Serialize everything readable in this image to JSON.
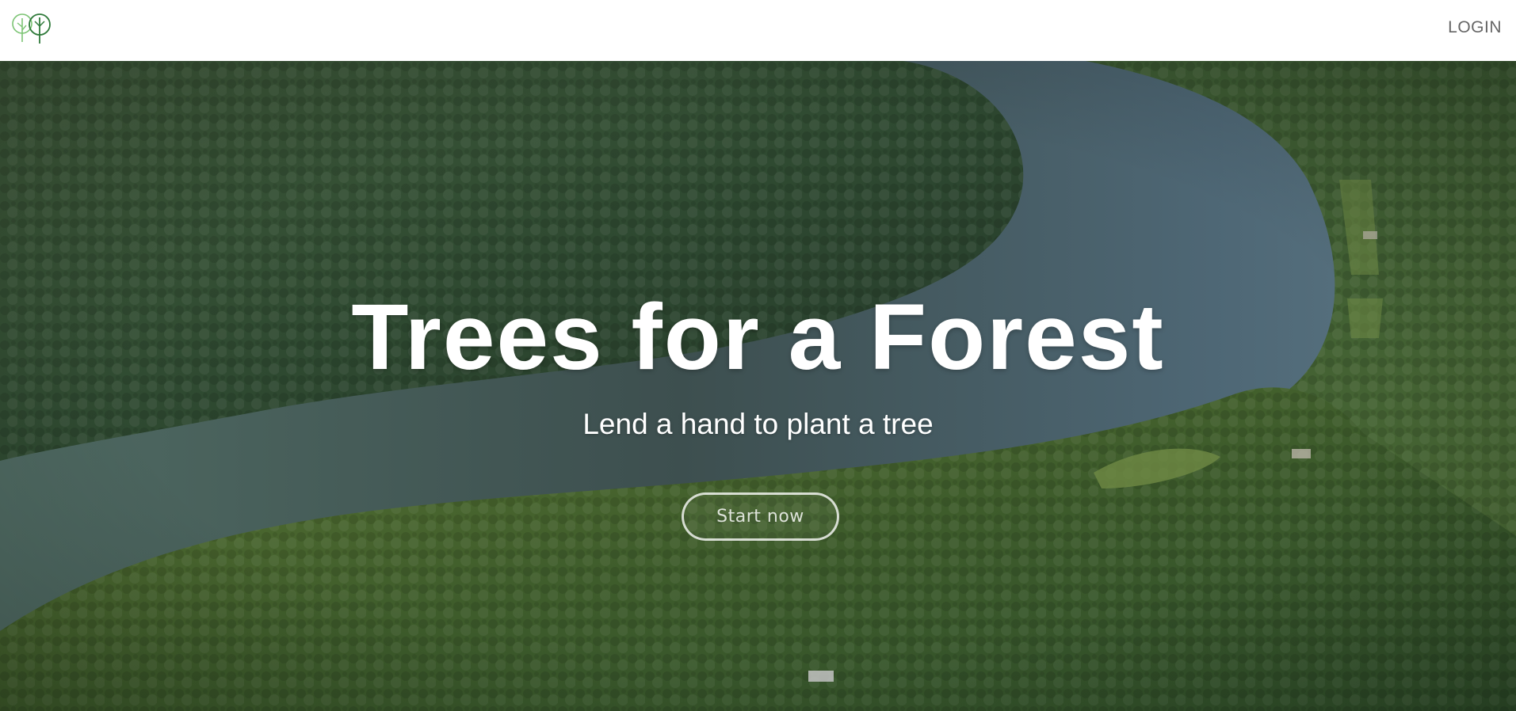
{
  "navbar": {
    "logo_icon": "two-trees-logo-icon",
    "login_label": "LOGIN"
  },
  "hero": {
    "background": "aerial-forest-river-photo",
    "title": "Trees for a Forest",
    "subtitle": "Lend a hand to plant a tree",
    "cta_label": "Start now"
  },
  "colors": {
    "logo_green": "#5aaa57",
    "logo_dark_green": "#2f7a3a",
    "nav_text": "#666666",
    "hero_text": "#ffffff"
  }
}
